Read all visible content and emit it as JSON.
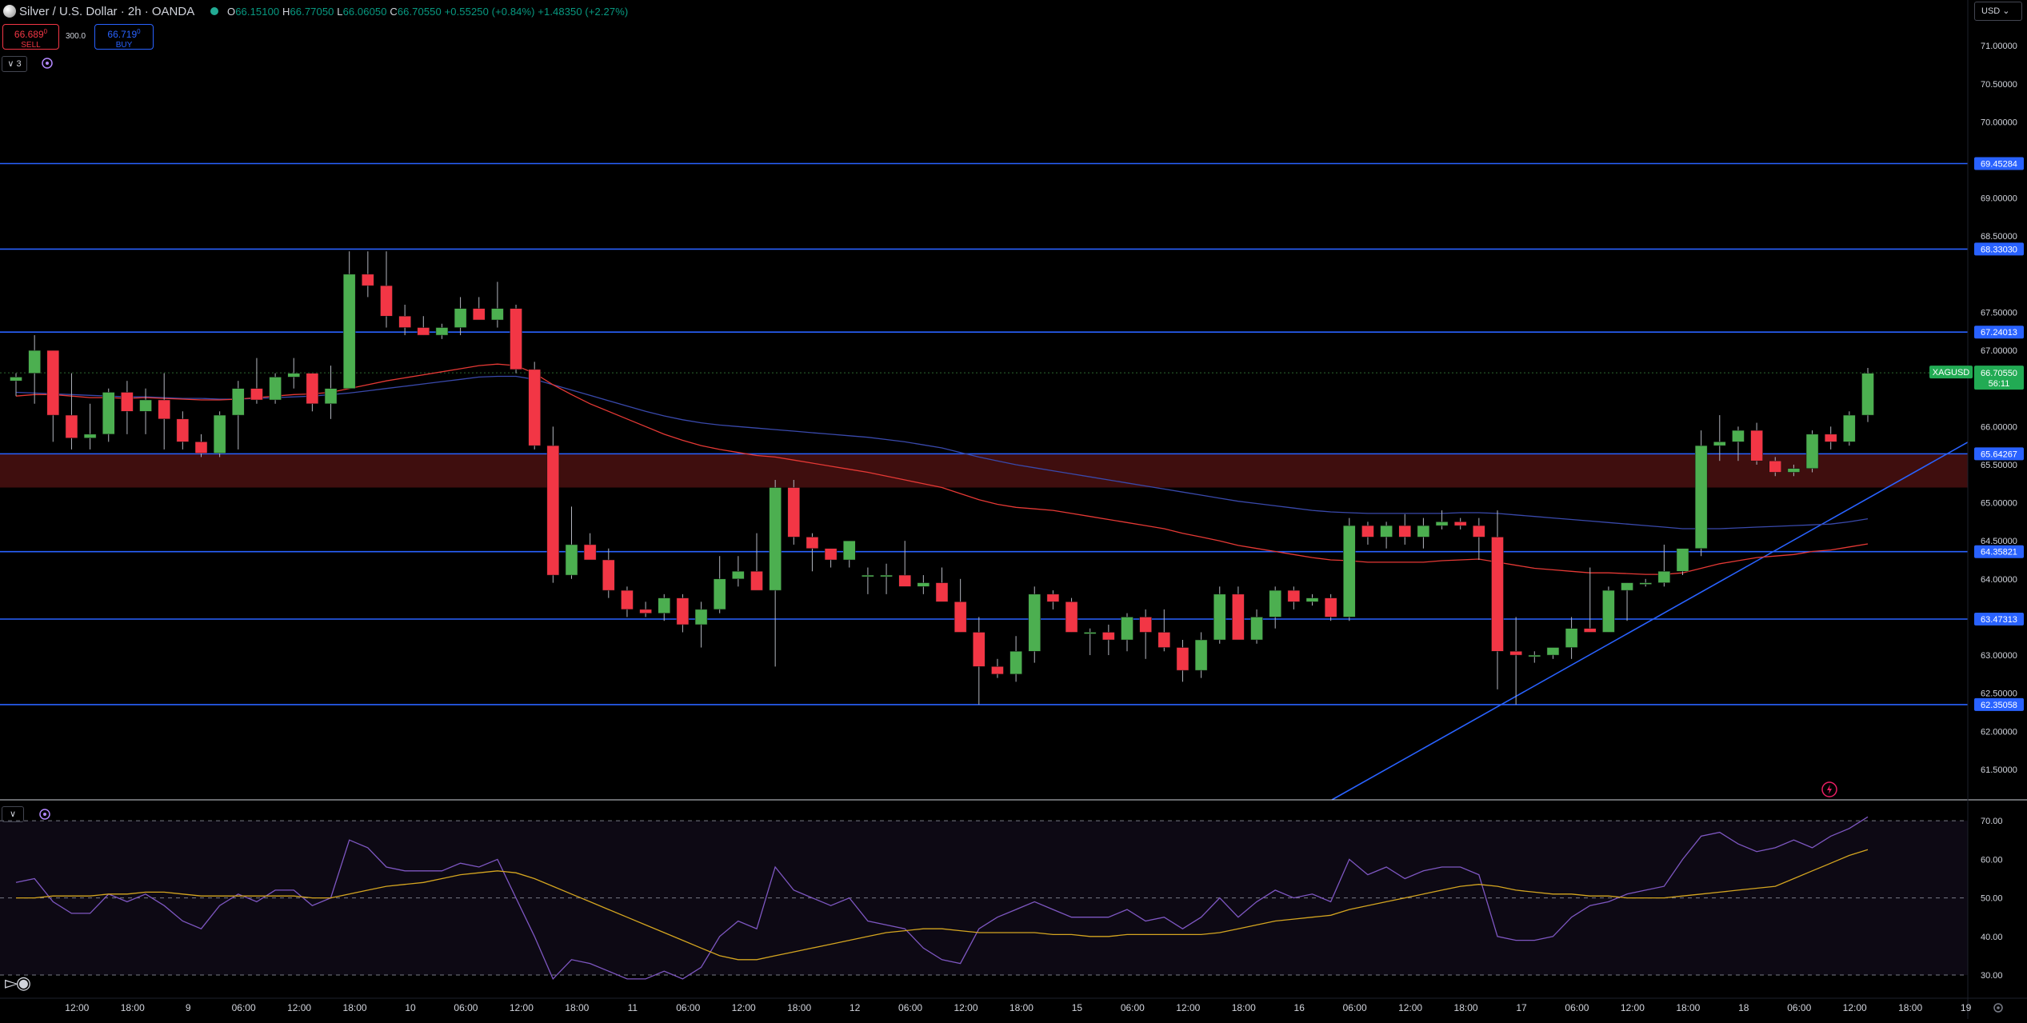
{
  "header": {
    "title": "Silver / U.S. Dollar · 2h · OANDA",
    "ohlc_open_label": "O",
    "ohlc_open": "66.15100",
    "ohlc_high_label": "H",
    "ohlc_high": "66.77050",
    "ohlc_low_label": "L",
    "ohlc_low": "66.06050",
    "ohlc_close_label": "C",
    "ohlc_close": "66.70550",
    "change": "+0.55250 (+0.84%)",
    "change_period": "+1.48350 (+2.27%)"
  },
  "trade": {
    "sell_price_main": "66.689",
    "sell_price_sup": "0",
    "sell_label": "SELL",
    "buy_price_main": "66.719",
    "buy_price_sup": "0",
    "buy_label": "BUY",
    "spread": "300.0"
  },
  "toolbar": {
    "collapse_label": "∨ 3",
    "currency": "USD"
  },
  "rsi_panel": {
    "collapse_label": "∨"
  },
  "colors": {
    "bull": "#4caf50",
    "bear": "#f23645",
    "hline": "#2962ff",
    "ma_red": "#e53935",
    "ma_blue": "#3949ab",
    "rsi_line": "#7e57c2",
    "rsi_ma": "#d4a520",
    "zone": "#4a1010"
  },
  "chart_data": [
    {
      "type": "candlestick",
      "symbol": "XAGUSD",
      "ylim": [
        61.1,
        71.6
      ],
      "price_ticks": [
        "71.00000",
        "70.50000",
        "70.00000",
        "69.00000",
        "68.50000",
        "67.50000",
        "67.00000",
        "66.00000",
        "65.50000",
        "65.00000",
        "64.50000",
        "64.00000",
        "63.00000",
        "62.50000",
        "62.00000",
        "61.50000"
      ],
      "horizontal_levels": [
        {
          "value": 69.45284,
          "label": "69.45284"
        },
        {
          "value": 68.3303,
          "label": "68.33030"
        },
        {
          "value": 67.24013,
          "label": "67.24013"
        },
        {
          "value": 65.64267,
          "label": "65.64267"
        },
        {
          "value": 64.35821,
          "label": "64.35821"
        },
        {
          "value": 63.47313,
          "label": "63.47313"
        },
        {
          "value": 62.35058,
          "label": "62.35058"
        }
      ],
      "zone": [
        65.2,
        65.64
      ],
      "last_price": {
        "symbol": "XAGUSD",
        "value": 66.7055,
        "label": "66.70550",
        "countdown": "56:11"
      },
      "time_labels": [
        {
          "i": 2,
          "t": "12:00"
        },
        {
          "i": 5,
          "t": "18:00"
        },
        {
          "i": 8,
          "t": "9"
        },
        {
          "i": 11,
          "t": "06:00"
        },
        {
          "i": 14,
          "t": "12:00"
        },
        {
          "i": 17,
          "t": "18:00"
        },
        {
          "i": 20,
          "t": "10"
        },
        {
          "i": 23,
          "t": "06:00"
        },
        {
          "i": 26,
          "t": "12:00"
        },
        {
          "i": 29,
          "t": "18:00"
        },
        {
          "i": 32,
          "t": "11"
        },
        {
          "i": 35,
          "t": "06:00"
        },
        {
          "i": 38,
          "t": "12:00"
        },
        {
          "i": 41,
          "t": "18:00"
        },
        {
          "i": 44,
          "t": "12"
        },
        {
          "i": 47,
          "t": "06:00"
        },
        {
          "i": 50,
          "t": "12:00"
        },
        {
          "i": 53,
          "t": "18:00"
        },
        {
          "i": 56,
          "t": "15"
        },
        {
          "i": 59,
          "t": "06:00"
        },
        {
          "i": 62,
          "t": "12:00"
        },
        {
          "i": 65,
          "t": "18:00"
        },
        {
          "i": 68,
          "t": "16"
        },
        {
          "i": 71,
          "t": "06:00"
        },
        {
          "i": 74,
          "t": "12:00"
        },
        {
          "i": 77,
          "t": "18:00"
        },
        {
          "i": 80,
          "t": "17"
        },
        {
          "i": 83,
          "t": "06:00"
        },
        {
          "i": 86,
          "t": "12:00"
        },
        {
          "i": 89,
          "t": "18:00"
        },
        {
          "i": 92,
          "t": "18"
        },
        {
          "i": 95,
          "t": "06:00"
        },
        {
          "i": 98,
          "t": "12:00"
        },
        {
          "i": 101,
          "t": "18:00"
        },
        {
          "i": 104,
          "t": "19"
        }
      ],
      "candles": [
        [
          66.6,
          66.7,
          66.4,
          66.65
        ],
        [
          66.7,
          67.2,
          66.3,
          67.0
        ],
        [
          67.0,
          67.0,
          65.8,
          66.15
        ],
        [
          66.15,
          66.7,
          65.7,
          65.85
        ],
        [
          65.85,
          66.3,
          65.7,
          65.9
        ],
        [
          65.9,
          66.5,
          65.8,
          66.45
        ],
        [
          66.45,
          66.6,
          65.9,
          66.2
        ],
        [
          66.2,
          66.5,
          65.9,
          66.35
        ],
        [
          66.35,
          66.7,
          65.7,
          66.1
        ],
        [
          66.1,
          66.2,
          65.7,
          65.8
        ],
        [
          65.8,
          65.9,
          65.6,
          65.65
        ],
        [
          65.65,
          66.2,
          65.6,
          66.15
        ],
        [
          66.15,
          66.6,
          65.7,
          66.5
        ],
        [
          66.5,
          66.9,
          66.3,
          66.35
        ],
        [
          66.35,
          66.7,
          66.3,
          66.65
        ],
        [
          66.65,
          66.9,
          66.5,
          66.7
        ],
        [
          66.7,
          66.7,
          66.2,
          66.3
        ],
        [
          66.3,
          66.8,
          66.1,
          66.5
        ],
        [
          66.5,
          68.3,
          66.5,
          68.0
        ],
        [
          68.0,
          68.3,
          67.7,
          67.85
        ],
        [
          67.85,
          68.3,
          67.3,
          67.45
        ],
        [
          67.45,
          67.6,
          67.2,
          67.3
        ],
        [
          67.3,
          67.45,
          67.2,
          67.2
        ],
        [
          67.2,
          67.35,
          67.15,
          67.3
        ],
        [
          67.3,
          67.7,
          67.2,
          67.55
        ],
        [
          67.55,
          67.7,
          67.4,
          67.4
        ],
        [
          67.4,
          67.9,
          67.3,
          67.55
        ],
        [
          67.55,
          67.6,
          66.7,
          66.75
        ],
        [
          66.75,
          66.85,
          65.7,
          65.75
        ],
        [
          65.75,
          66.0,
          63.95,
          64.05
        ],
        [
          64.05,
          64.95,
          64.0,
          64.45
        ],
        [
          64.45,
          64.6,
          64.3,
          64.25
        ],
        [
          64.25,
          64.4,
          63.75,
          63.85
        ],
        [
          63.85,
          63.9,
          63.5,
          63.6
        ],
        [
          63.6,
          63.7,
          63.5,
          63.55
        ],
        [
          63.55,
          63.8,
          63.45,
          63.75
        ],
        [
          63.75,
          63.8,
          63.3,
          63.4
        ],
        [
          63.4,
          63.7,
          63.1,
          63.6
        ],
        [
          63.6,
          64.3,
          63.55,
          64.0
        ],
        [
          64.0,
          64.3,
          63.9,
          64.1
        ],
        [
          64.1,
          64.6,
          63.95,
          63.85
        ],
        [
          63.85,
          65.3,
          62.85,
          65.2
        ],
        [
          65.2,
          65.3,
          64.45,
          64.55
        ],
        [
          64.55,
          64.6,
          64.1,
          64.4
        ],
        [
          64.4,
          64.4,
          64.15,
          64.25
        ],
        [
          64.25,
          64.5,
          64.15,
          64.5
        ],
        [
          64.05,
          64.15,
          63.8,
          64.05
        ],
        [
          64.05,
          64.2,
          63.8,
          64.05
        ],
        [
          64.05,
          64.5,
          63.95,
          63.9
        ],
        [
          63.9,
          64.05,
          63.8,
          63.95
        ],
        [
          63.95,
          64.15,
          63.75,
          63.7
        ],
        [
          63.7,
          64.0,
          63.3,
          63.3
        ],
        [
          63.3,
          63.5,
          62.35,
          62.85
        ],
        [
          62.85,
          62.95,
          62.7,
          62.75
        ],
        [
          62.75,
          63.25,
          62.65,
          63.05
        ],
        [
          63.05,
          63.9,
          62.9,
          63.8
        ],
        [
          63.8,
          63.85,
          63.6,
          63.7
        ],
        [
          63.7,
          63.75,
          63.3,
          63.3
        ],
        [
          63.3,
          63.35,
          63.0,
          63.3
        ],
        [
          63.3,
          63.4,
          63.0,
          63.2
        ],
        [
          63.2,
          63.55,
          63.05,
          63.5
        ],
        [
          63.5,
          63.6,
          62.95,
          63.3
        ],
        [
          63.3,
          63.6,
          63.05,
          63.1
        ],
        [
          63.1,
          63.2,
          62.65,
          62.8
        ],
        [
          62.8,
          63.3,
          62.7,
          63.2
        ],
        [
          63.2,
          63.9,
          63.15,
          63.8
        ],
        [
          63.8,
          63.9,
          63.2,
          63.2
        ],
        [
          63.2,
          63.6,
          63.15,
          63.5
        ],
        [
          63.5,
          63.9,
          63.35,
          63.85
        ],
        [
          63.85,
          63.9,
          63.6,
          63.7
        ],
        [
          63.7,
          63.8,
          63.65,
          63.75
        ],
        [
          63.75,
          63.8,
          63.45,
          63.5
        ],
        [
          63.5,
          64.8,
          63.45,
          64.7
        ],
        [
          64.7,
          64.75,
          64.45,
          64.55
        ],
        [
          64.55,
          64.75,
          64.4,
          64.7
        ],
        [
          64.7,
          64.85,
          64.45,
          64.55
        ],
        [
          64.55,
          64.8,
          64.4,
          64.7
        ],
        [
          64.7,
          64.9,
          64.65,
          64.75
        ],
        [
          64.75,
          64.8,
          64.65,
          64.7
        ],
        [
          64.7,
          64.8,
          64.25,
          64.55
        ],
        [
          64.55,
          64.9,
          62.55,
          63.05
        ],
        [
          63.05,
          63.5,
          62.35,
          63.0
        ],
        [
          63.0,
          63.05,
          62.9,
          63.0
        ],
        [
          63.0,
          63.1,
          62.95,
          63.1
        ],
        [
          63.1,
          63.5,
          62.95,
          63.35
        ],
        [
          63.35,
          64.15,
          63.3,
          63.3
        ],
        [
          63.3,
          63.9,
          63.3,
          63.85
        ],
        [
          63.85,
          63.95,
          63.45,
          63.95
        ],
        [
          63.95,
          64.0,
          63.9,
          63.95
        ],
        [
          63.95,
          64.45,
          63.9,
          64.1
        ],
        [
          64.1,
          64.4,
          64.05,
          64.4
        ],
        [
          64.4,
          65.95,
          64.3,
          65.75
        ],
        [
          65.75,
          66.15,
          65.55,
          65.8
        ],
        [
          65.8,
          66.0,
          65.55,
          65.95
        ],
        [
          65.95,
          66.05,
          65.5,
          65.55
        ],
        [
          65.55,
          65.6,
          65.35,
          65.4
        ],
        [
          65.4,
          65.5,
          65.35,
          65.45
        ],
        [
          65.45,
          65.95,
          65.4,
          65.9
        ],
        [
          65.9,
          66.0,
          65.7,
          65.8
        ],
        [
          65.8,
          66.2,
          65.75,
          66.15
        ],
        [
          66.15,
          66.77,
          66.06,
          66.7
        ]
      ],
      "ma_red": [
        66.4,
        66.42,
        66.42,
        66.4,
        66.38,
        66.38,
        66.37,
        66.38,
        66.37,
        66.36,
        66.35,
        66.35,
        66.36,
        66.38,
        66.4,
        66.42,
        66.43,
        66.45,
        66.5,
        66.55,
        66.6,
        66.64,
        66.68,
        66.72,
        66.76,
        66.8,
        66.82,
        66.8,
        66.7,
        66.55,
        66.42,
        66.3,
        66.2,
        66.1,
        66.0,
        65.9,
        65.82,
        65.75,
        65.7,
        65.66,
        65.62,
        65.6,
        65.56,
        65.52,
        65.48,
        65.44,
        65.4,
        65.35,
        65.3,
        65.25,
        65.2,
        65.12,
        65.04,
        64.98,
        64.94,
        64.92,
        64.9,
        64.86,
        64.82,
        64.78,
        64.74,
        64.7,
        64.66,
        64.6,
        64.55,
        64.5,
        64.44,
        64.4,
        64.36,
        64.32,
        64.28,
        64.25,
        64.24,
        64.22,
        64.22,
        64.22,
        64.22,
        64.24,
        64.25,
        64.26,
        64.22,
        64.18,
        64.14,
        64.12,
        64.1,
        64.08,
        64.08,
        64.07,
        64.06,
        64.06,
        64.08,
        64.14,
        64.2,
        64.24,
        64.28,
        64.3,
        64.32,
        64.36,
        64.38,
        64.42,
        64.46
      ],
      "ma_blue": [
        66.45,
        66.44,
        66.43,
        66.42,
        66.41,
        66.4,
        66.39,
        66.39,
        66.38,
        66.37,
        66.37,
        66.36,
        66.36,
        66.37,
        66.38,
        66.39,
        66.4,
        66.42,
        66.44,
        66.47,
        66.5,
        66.53,
        66.56,
        66.59,
        66.62,
        66.65,
        66.66,
        66.66,
        66.62,
        66.55,
        66.48,
        66.41,
        66.34,
        66.27,
        66.2,
        66.14,
        66.09,
        66.05,
        66.02,
        66.0,
        65.98,
        65.96,
        65.94,
        65.92,
        65.9,
        65.88,
        65.86,
        65.83,
        65.8,
        65.76,
        65.72,
        65.66,
        65.6,
        65.55,
        65.5,
        65.46,
        65.42,
        65.38,
        65.34,
        65.3,
        65.26,
        65.22,
        65.18,
        65.14,
        65.1,
        65.06,
        65.02,
        64.99,
        64.96,
        64.93,
        64.9,
        64.88,
        64.87,
        64.86,
        64.86,
        64.86,
        64.86,
        64.86,
        64.87,
        64.87,
        64.86,
        64.84,
        64.82,
        64.8,
        64.78,
        64.76,
        64.74,
        64.72,
        64.7,
        64.68,
        64.66,
        64.66,
        64.66,
        64.67,
        64.68,
        64.69,
        64.7,
        64.71,
        64.72,
        64.75,
        64.79
      ]
    },
    {
      "type": "line",
      "name": "RSI",
      "ylim": [
        24,
        75
      ],
      "ticks": [
        "70.00",
        "60.00",
        "50.00",
        "40.00",
        "30.00"
      ],
      "rsi": [
        54,
        55,
        49,
        46,
        46,
        51,
        49,
        51,
        48,
        44,
        42,
        48,
        51,
        49,
        52,
        52,
        48,
        50,
        65,
        63,
        58,
        57,
        57,
        57,
        59,
        58,
        60,
        50,
        40,
        29,
        34,
        33,
        31,
        29,
        29,
        31,
        29,
        32,
        40,
        44,
        42,
        58,
        52,
        50,
        48,
        50,
        44,
        43,
        42,
        37,
        34,
        33,
        42,
        45,
        47,
        49,
        47,
        45,
        45,
        45,
        47,
        44,
        45,
        42,
        45,
        50,
        45,
        49,
        52,
        50,
        51,
        49,
        60,
        56,
        58,
        55,
        57,
        58,
        58,
        56,
        40,
        39,
        39,
        40,
        45,
        48,
        49,
        51,
        52,
        53,
        60,
        66,
        67,
        64,
        62,
        63,
        65,
        63,
        66,
        68,
        71
      ],
      "rsi_ma": [
        50,
        50,
        50.5,
        50.5,
        50.5,
        51,
        51,
        51.5,
        51.5,
        51,
        50.5,
        50.5,
        50.5,
        50.5,
        50.5,
        50.5,
        50,
        50,
        51,
        52,
        53,
        53.5,
        54,
        55,
        56,
        56.5,
        57,
        56.5,
        55,
        53,
        51,
        49,
        47,
        45,
        43,
        41,
        39,
        37,
        35,
        34,
        34,
        35,
        36,
        37,
        38,
        39,
        40,
        41,
        41.5,
        42,
        42,
        41.5,
        41,
        41,
        41,
        41,
        40.5,
        40.5,
        40,
        40,
        40.5,
        40.5,
        40.5,
        40.5,
        40.5,
        41,
        42,
        43,
        44,
        44.5,
        45,
        45.5,
        47,
        48,
        49,
        50,
        51,
        52,
        53,
        53.5,
        53,
        52,
        51.5,
        51,
        51,
        50.5,
        50.5,
        50,
        50,
        50,
        50.5,
        51,
        51.5,
        52,
        52.5,
        53,
        55,
        57,
        59,
        61,
        62.5
      ]
    }
  ]
}
